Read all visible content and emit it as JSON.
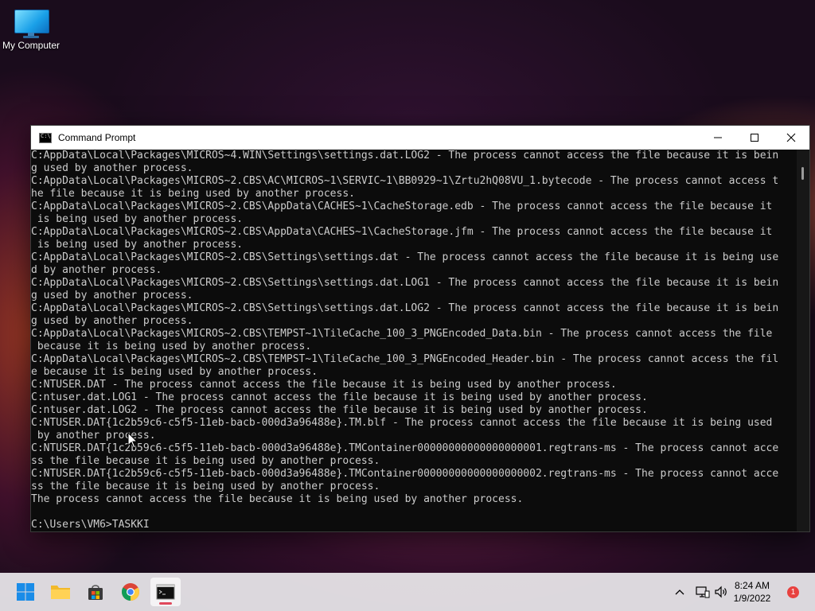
{
  "desktop": {
    "icons": [
      {
        "label": "My Computer"
      }
    ]
  },
  "window": {
    "title": "Command Prompt",
    "controls": {
      "minimize": "─",
      "maximize": "☐",
      "close": "✕"
    },
    "console_lines": [
      "C:AppData\\Local\\Packages\\MICROS~4.WIN\\Settings\\settings.dat.LOG2 - The process cannot access the file because it is bein",
      "g used by another process.",
      "C:AppData\\Local\\Packages\\MICROS~2.CBS\\AC\\MICROS~1\\SERVIC~1\\BB0929~1\\Zrtu2hQ08VU_1.bytecode - The process cannot access t",
      "he file because it is being used by another process.",
      "C:AppData\\Local\\Packages\\MICROS~2.CBS\\AppData\\CACHES~1\\CacheStorage.edb - The process cannot access the file because it",
      " is being used by another process.",
      "C:AppData\\Local\\Packages\\MICROS~2.CBS\\AppData\\CACHES~1\\CacheStorage.jfm - The process cannot access the file because it",
      " is being used by another process.",
      "C:AppData\\Local\\Packages\\MICROS~2.CBS\\Settings\\settings.dat - The process cannot access the file because it is being use",
      "d by another process.",
      "C:AppData\\Local\\Packages\\MICROS~2.CBS\\Settings\\settings.dat.LOG1 - The process cannot access the file because it is bein",
      "g used by another process.",
      "C:AppData\\Local\\Packages\\MICROS~2.CBS\\Settings\\settings.dat.LOG2 - The process cannot access the file because it is bein",
      "g used by another process.",
      "C:AppData\\Local\\Packages\\MICROS~2.CBS\\TEMPST~1\\TileCache_100_3_PNGEncoded_Data.bin - The process cannot access the file",
      " because it is being used by another process.",
      "C:AppData\\Local\\Packages\\MICROS~2.CBS\\TEMPST~1\\TileCache_100_3_PNGEncoded_Header.bin - The process cannot access the fil",
      "e because it is being used by another process.",
      "C:NTUSER.DAT - The process cannot access the file because it is being used by another process.",
      "C:ntuser.dat.LOG1 - The process cannot access the file because it is being used by another process.",
      "C:ntuser.dat.LOG2 - The process cannot access the file because it is being used by another process.",
      "C:NTUSER.DAT{1c2b59c6-c5f5-11eb-bacb-000d3a96488e}.TM.blf - The process cannot access the file because it is being used",
      " by another process.",
      "C:NTUSER.DAT{1c2b59c6-c5f5-11eb-bacb-000d3a96488e}.TMContainer00000000000000000001.regtrans-ms - The process cannot acce",
      "ss the file because it is being used by another process.",
      "C:NTUSER.DAT{1c2b59c6-c5f5-11eb-bacb-000d3a96488e}.TMContainer00000000000000000002.regtrans-ms - The process cannot acce",
      "ss the file because it is being used by another process.",
      "The process cannot access the file because it is being used by another process.",
      "",
      "C:\\Users\\VM6>TASKKI"
    ]
  },
  "taskbar": {
    "apps": [
      {
        "name": "start",
        "icon": "windows-logo-icon"
      },
      {
        "name": "file-explorer",
        "icon": "folder-icon"
      },
      {
        "name": "store",
        "icon": "store-bag-icon"
      },
      {
        "name": "chrome",
        "icon": "chrome-icon"
      },
      {
        "name": "command-prompt",
        "icon": "terminal-icon",
        "active": true
      }
    ],
    "clock": {
      "time": "8:24 AM",
      "date": "1/9/2022"
    },
    "notification_count": "1"
  },
  "colors": {
    "console_bg": "#0c0c0c",
    "console_text": "#cccccc",
    "taskbar_bg": "#ebe8ec",
    "notification": "#e8413f"
  }
}
